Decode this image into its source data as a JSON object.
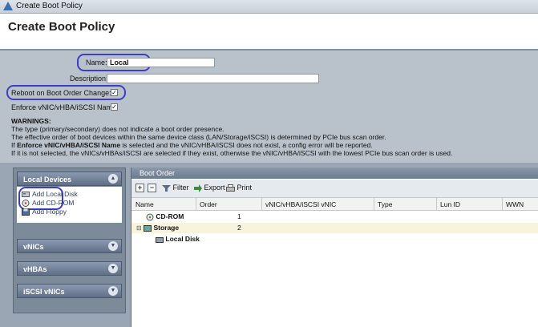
{
  "window": {
    "title": "Create Boot Policy"
  },
  "header": {
    "title": "Create Boot Policy"
  },
  "form": {
    "name_label": "Name:",
    "name_value": "Local",
    "description_label": "Description:",
    "description_value": "",
    "reboot_label": "Reboot on Boot Order Change:",
    "reboot_checked": "✓",
    "enforce_label": "Enforce vNIC/vHBA/iSCSI Name:",
    "enforce_checked": "✓"
  },
  "warnings": {
    "title": "WARNINGS:",
    "line1": "The type (primary/secondary) does not indicate a boot order presence.",
    "line2": "The effective order of boot devices within the same device class (LAN/Storage/iSCSI) is determined by PCIe bus scan order.",
    "line3_prefix": "If ",
    "line3_bold": "Enforce vNIC/vHBA/iSCSI Name",
    "line3_suffix": " is selected and the vNIC/vHBA/iSCSI does not exist, a config error will be reported.",
    "line4": "If it is not selected, the vNICs/vHBAs/iSCSI are selected if they exist, otherwise the vNIC/vHBA/iSCSI with the lowest PCIe bus scan order is used."
  },
  "left_panel": {
    "local_devices": {
      "label": "Local Devices",
      "items": [
        {
          "label": "Add Local Disk",
          "icon": "disk-icon"
        },
        {
          "label": "Add CD-ROM",
          "icon": "cdrom-icon"
        },
        {
          "label": "Add Floppy",
          "icon": "floppy-icon"
        }
      ]
    },
    "vnics": {
      "label": "vNICs"
    },
    "vhbas": {
      "label": "vHBAs"
    },
    "iscsi_vnics": {
      "label": "iSCSI vNICs"
    }
  },
  "boot_order": {
    "title": "Boot Order",
    "toolbar": {
      "add": "+",
      "remove": "−",
      "filter": "Filter",
      "export": "Export",
      "print": "Print"
    },
    "columns": [
      "Name",
      "Order",
      "vNIC/vHBA/iSCSI vNIC",
      "Type",
      "Lun ID",
      "WWN"
    ],
    "rows": [
      {
        "name": "CD-ROM",
        "order": "1",
        "icon": "cdrom-icon"
      },
      {
        "name": "Storage",
        "order": "2",
        "icon": "storage-icon"
      },
      {
        "name": "Local Disk",
        "order": "",
        "icon": "disk-icon"
      }
    ]
  },
  "colors": {
    "highlight": "#3d3dc8",
    "form_bg": "#b9c2cb",
    "panel_bg": "#7c8a9a"
  }
}
